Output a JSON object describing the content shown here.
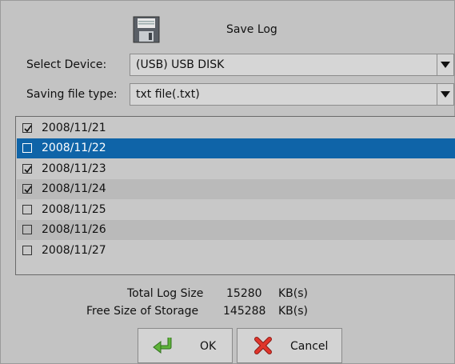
{
  "dialog": {
    "title": "Save Log",
    "icon": "floppy-disk-icon"
  },
  "device": {
    "label": "Select Device:",
    "value": "(USB)  USB DISK"
  },
  "file_type": {
    "label": "Saving file type:",
    "value": "txt file(.txt)"
  },
  "logs": [
    {
      "date": "2008/11/21",
      "checked": true
    },
    {
      "date": "2008/11/22",
      "checked": false,
      "selected": true
    },
    {
      "date": "2008/11/23",
      "checked": true
    },
    {
      "date": "2008/11/24",
      "checked": true
    },
    {
      "date": "2008/11/25",
      "checked": false
    },
    {
      "date": "2008/11/26",
      "checked": false
    },
    {
      "date": "2008/11/27",
      "checked": false
    }
  ],
  "summary": {
    "total_label": "Total Log Size",
    "total_value": "15280",
    "total_unit": "KB(s)",
    "free_label": "Free Size of Storage",
    "free_value": "145288",
    "free_unit": "KB(s)"
  },
  "buttons": {
    "ok_label": "OK",
    "cancel_label": "Cancel"
  },
  "colors": {
    "selection": "#0f64a8",
    "ok_icon": "#4a9a2e",
    "cancel_icon": "#d3322b"
  }
}
